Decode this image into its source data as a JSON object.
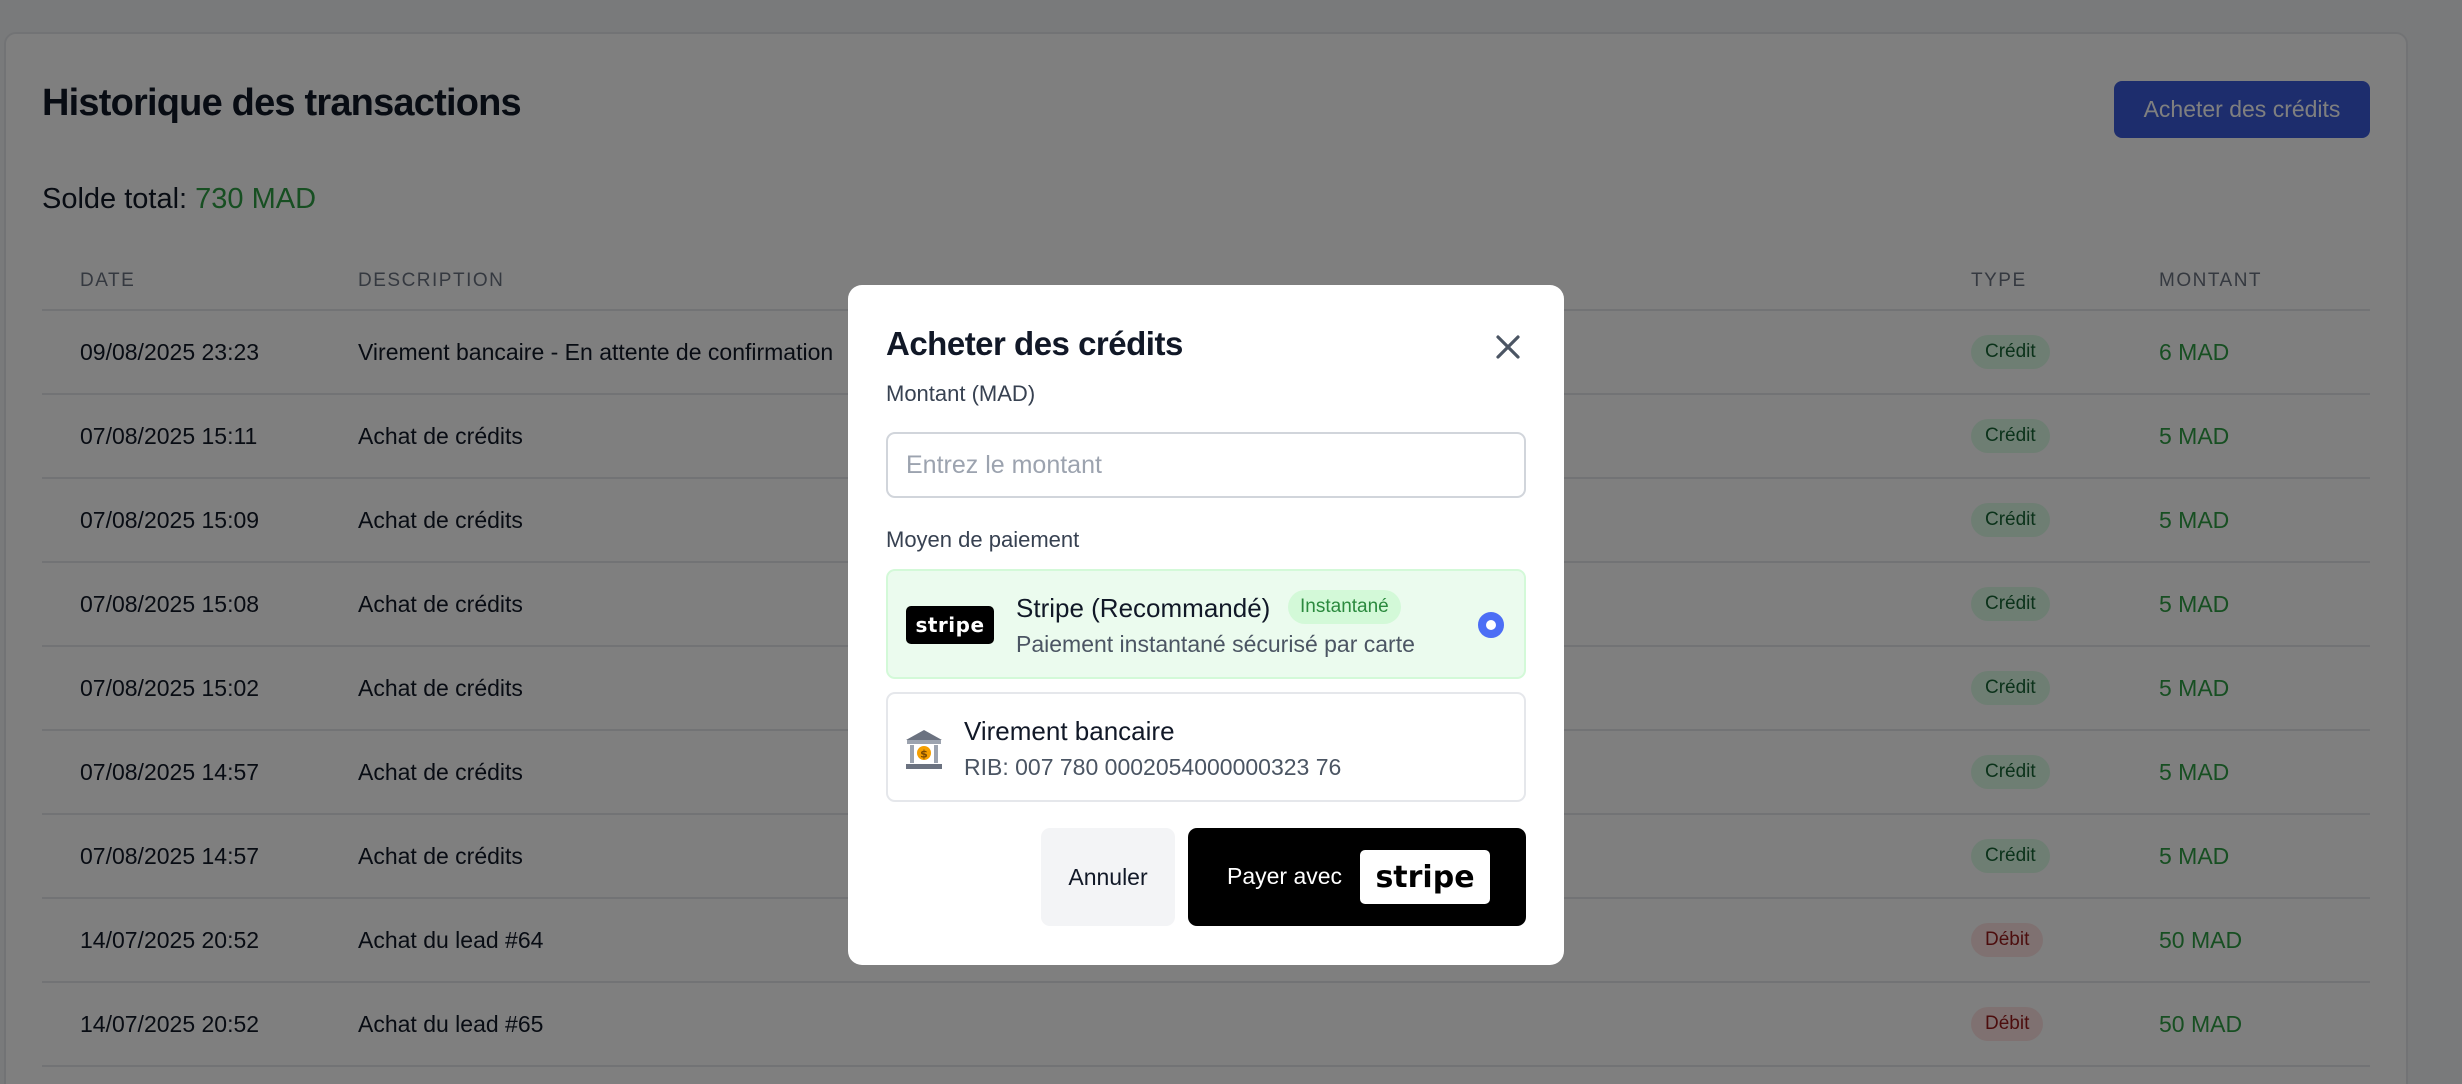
{
  "header": {
    "title": "Historique des transactions",
    "buy_button": "Acheter des crédits"
  },
  "balance": {
    "label": "Solde total:",
    "amount": "730 MAD"
  },
  "table": {
    "columns": [
      "DATE",
      "DESCRIPTION",
      "TYPE",
      "MONTANT"
    ],
    "rows": [
      {
        "date": "09/08/2025 23:23",
        "description": "Virement bancaire - En attente de confirmation",
        "type": "Crédit",
        "kind": "credit",
        "amount": "6 MAD"
      },
      {
        "date": "07/08/2025 15:11",
        "description": "Achat de crédits",
        "type": "Crédit",
        "kind": "credit",
        "amount": "5 MAD"
      },
      {
        "date": "07/08/2025 15:09",
        "description": "Achat de crédits",
        "type": "Crédit",
        "kind": "credit",
        "amount": "5 MAD"
      },
      {
        "date": "07/08/2025 15:08",
        "description": "Achat de crédits",
        "type": "Crédit",
        "kind": "credit",
        "amount": "5 MAD"
      },
      {
        "date": "07/08/2025 15:02",
        "description": "Achat de crédits",
        "type": "Crédit",
        "kind": "credit",
        "amount": "5 MAD"
      },
      {
        "date": "07/08/2025 14:57",
        "description": "Achat de crédits",
        "type": "Crédit",
        "kind": "credit",
        "amount": "5 MAD"
      },
      {
        "date": "07/08/2025 14:57",
        "description": "Achat de crédits",
        "type": "Crédit",
        "kind": "credit",
        "amount": "5 MAD"
      },
      {
        "date": "14/07/2025 20:52",
        "description": "Achat du lead #64",
        "type": "Débit",
        "kind": "debit",
        "amount": "50 MAD"
      },
      {
        "date": "14/07/2025 20:52",
        "description": "Achat du lead #65",
        "type": "Débit",
        "kind": "debit",
        "amount": "50 MAD"
      }
    ]
  },
  "modal": {
    "title": "Acheter des crédits",
    "amount_label": "Montant (MAD)",
    "amount_placeholder": "Entrez le montant",
    "amount_value": "",
    "payment_label": "Moyen de paiement",
    "stripe": {
      "logo": "stripe",
      "title": "Stripe (Recommandé)",
      "badge": "Instantané",
      "subtitle": "Paiement instantané sécurisé par carte",
      "selected": true
    },
    "bank": {
      "icon": "bank-icon",
      "title": "Virement bancaire",
      "subtitle": "RIB: 007 780 0002054000000323 76"
    },
    "cancel_label": "Annuler",
    "pay_label": "Payer avec",
    "pay_logo": "stripe"
  },
  "colors": {
    "primary": "#3b5bdb",
    "positive": "#2f9e44",
    "overlay": "rgba(0,0,0,0.5)"
  }
}
